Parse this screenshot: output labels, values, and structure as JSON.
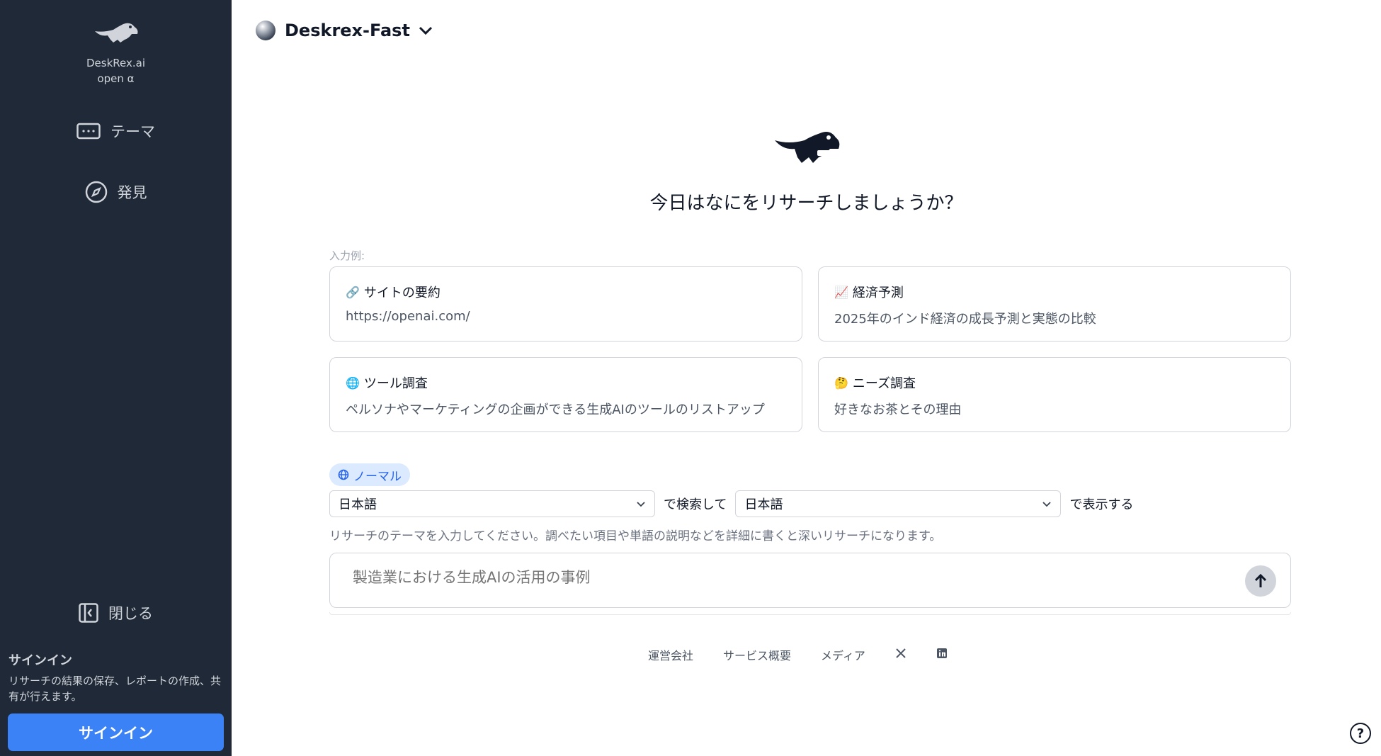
{
  "brand": {
    "name": "DeskRex.ai",
    "sub": "open α"
  },
  "sidebar": {
    "nav": [
      {
        "label": "テーマ",
        "icon": "theme-icon"
      },
      {
        "label": "発見",
        "icon": "compass-icon"
      }
    ],
    "close_label": "閉じる",
    "signin_title": "サインイン",
    "signin_desc": "リサーチの結果の保存、レポートの作成、共有が行えます。",
    "signin_button": "サインイン"
  },
  "header": {
    "model_name": "Deskrex-Fast"
  },
  "main": {
    "hero_title": "今日はなにをリサーチしましょうか？",
    "examples_label": "入力例:",
    "cards": [
      {
        "emoji": "🔗",
        "title": "サイトの要約",
        "text": "https://openai.com/"
      },
      {
        "emoji": "📈",
        "title": "経済予測",
        "text": "2025年のインド経済の成長予測と実態の比較"
      },
      {
        "emoji": "🌐",
        "title": "ツール調査",
        "text": "ペルソナやマーケティングの企画ができる生成AIのツールのリストアップ"
      },
      {
        "emoji": "🤔",
        "title": "ニーズ調査",
        "text": "好きなお茶とその理由"
      }
    ],
    "mode_label": "ノーマル",
    "search_language": "日本語",
    "search_suffix": "で検索して",
    "display_language": "日本語",
    "display_suffix": "で表示する",
    "hint": "リサーチのテーマを入力してください。調べたい項目や単語の説明などを詳細に書くと深いリサーチになります。",
    "query_placeholder": "製造業における生成AIの活用の事例"
  },
  "footer": {
    "links": [
      "運営会社",
      "サービス概要",
      "メディア"
    ],
    "social": [
      "x-icon",
      "linkedin-icon"
    ]
  },
  "help_label": "?",
  "colors": {
    "sidebar_bg": "#1f2937",
    "accent": "#3b82f6",
    "pill_bg": "#dbeafe",
    "pill_text": "#2563eb"
  }
}
